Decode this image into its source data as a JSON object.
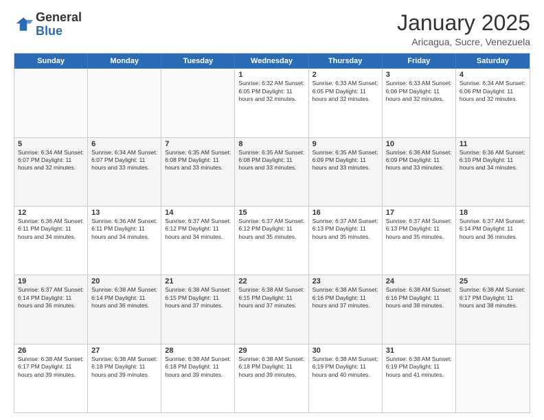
{
  "logo": {
    "general": "General",
    "blue": "Blue"
  },
  "title": "January 2025",
  "subtitle": "Aricagua, Sucre, Venezuela",
  "header_days": [
    "Sunday",
    "Monday",
    "Tuesday",
    "Wednesday",
    "Thursday",
    "Friday",
    "Saturday"
  ],
  "weeks": [
    [
      {
        "day": "",
        "info": ""
      },
      {
        "day": "",
        "info": ""
      },
      {
        "day": "",
        "info": ""
      },
      {
        "day": "1",
        "info": "Sunrise: 6:32 AM\nSunset: 6:05 PM\nDaylight: 11 hours\nand 32 minutes."
      },
      {
        "day": "2",
        "info": "Sunrise: 6:33 AM\nSunset: 6:05 PM\nDaylight: 11 hours\nand 32 minutes."
      },
      {
        "day": "3",
        "info": "Sunrise: 6:33 AM\nSunset: 6:06 PM\nDaylight: 11 hours\nand 32 minutes."
      },
      {
        "day": "4",
        "info": "Sunrise: 6:34 AM\nSunset: 6:06 PM\nDaylight: 11 hours\nand 32 minutes."
      }
    ],
    [
      {
        "day": "5",
        "info": "Sunrise: 6:34 AM\nSunset: 6:07 PM\nDaylight: 11 hours\nand 32 minutes."
      },
      {
        "day": "6",
        "info": "Sunrise: 6:34 AM\nSunset: 6:07 PM\nDaylight: 11 hours\nand 33 minutes."
      },
      {
        "day": "7",
        "info": "Sunrise: 6:35 AM\nSunset: 6:08 PM\nDaylight: 11 hours\nand 33 minutes."
      },
      {
        "day": "8",
        "info": "Sunrise: 6:35 AM\nSunset: 6:08 PM\nDaylight: 11 hours\nand 33 minutes."
      },
      {
        "day": "9",
        "info": "Sunrise: 6:35 AM\nSunset: 6:09 PM\nDaylight: 11 hours\nand 33 minutes."
      },
      {
        "day": "10",
        "info": "Sunrise: 6:36 AM\nSunset: 6:09 PM\nDaylight: 11 hours\nand 33 minutes."
      },
      {
        "day": "11",
        "info": "Sunrise: 6:36 AM\nSunset: 6:10 PM\nDaylight: 11 hours\nand 34 minutes."
      }
    ],
    [
      {
        "day": "12",
        "info": "Sunrise: 6:36 AM\nSunset: 6:11 PM\nDaylight: 11 hours\nand 34 minutes."
      },
      {
        "day": "13",
        "info": "Sunrise: 6:36 AM\nSunset: 6:11 PM\nDaylight: 11 hours\nand 34 minutes."
      },
      {
        "day": "14",
        "info": "Sunrise: 6:37 AM\nSunset: 6:12 PM\nDaylight: 11 hours\nand 34 minutes."
      },
      {
        "day": "15",
        "info": "Sunrise: 6:37 AM\nSunset: 6:12 PM\nDaylight: 11 hours\nand 35 minutes."
      },
      {
        "day": "16",
        "info": "Sunrise: 6:37 AM\nSunset: 6:13 PM\nDaylight: 11 hours\nand 35 minutes."
      },
      {
        "day": "17",
        "info": "Sunrise: 6:37 AM\nSunset: 6:13 PM\nDaylight: 11 hours\nand 35 minutes."
      },
      {
        "day": "18",
        "info": "Sunrise: 6:37 AM\nSunset: 6:14 PM\nDaylight: 11 hours\nand 36 minutes."
      }
    ],
    [
      {
        "day": "19",
        "info": "Sunrise: 6:37 AM\nSunset: 6:14 PM\nDaylight: 11 hours\nand 36 minutes."
      },
      {
        "day": "20",
        "info": "Sunrise: 6:38 AM\nSunset: 6:14 PM\nDaylight: 11 hours\nand 36 minutes."
      },
      {
        "day": "21",
        "info": "Sunrise: 6:38 AM\nSunset: 6:15 PM\nDaylight: 11 hours\nand 37 minutes."
      },
      {
        "day": "22",
        "info": "Sunrise: 6:38 AM\nSunset: 6:15 PM\nDaylight: 11 hours\nand 37 minutes."
      },
      {
        "day": "23",
        "info": "Sunrise: 6:38 AM\nSunset: 6:16 PM\nDaylight: 11 hours\nand 37 minutes."
      },
      {
        "day": "24",
        "info": "Sunrise: 6:38 AM\nSunset: 6:16 PM\nDaylight: 11 hours\nand 38 minutes."
      },
      {
        "day": "25",
        "info": "Sunrise: 6:38 AM\nSunset: 6:17 PM\nDaylight: 11 hours\nand 38 minutes."
      }
    ],
    [
      {
        "day": "26",
        "info": "Sunrise: 6:38 AM\nSunset: 6:17 PM\nDaylight: 11 hours\nand 39 minutes."
      },
      {
        "day": "27",
        "info": "Sunrise: 6:38 AM\nSunset: 6:18 PM\nDaylight: 11 hours\nand 39 minutes."
      },
      {
        "day": "28",
        "info": "Sunrise: 6:38 AM\nSunset: 6:18 PM\nDaylight: 11 hours\nand 39 minutes."
      },
      {
        "day": "29",
        "info": "Sunrise: 6:38 AM\nSunset: 6:18 PM\nDaylight: 11 hours\nand 39 minutes."
      },
      {
        "day": "30",
        "info": "Sunrise: 6:38 AM\nSunset: 6:19 PM\nDaylight: 11 hours\nand 40 minutes."
      },
      {
        "day": "31",
        "info": "Sunrise: 6:38 AM\nSunset: 6:19 PM\nDaylight: 11 hours\nand 41 minutes."
      },
      {
        "day": "",
        "info": ""
      }
    ]
  ]
}
